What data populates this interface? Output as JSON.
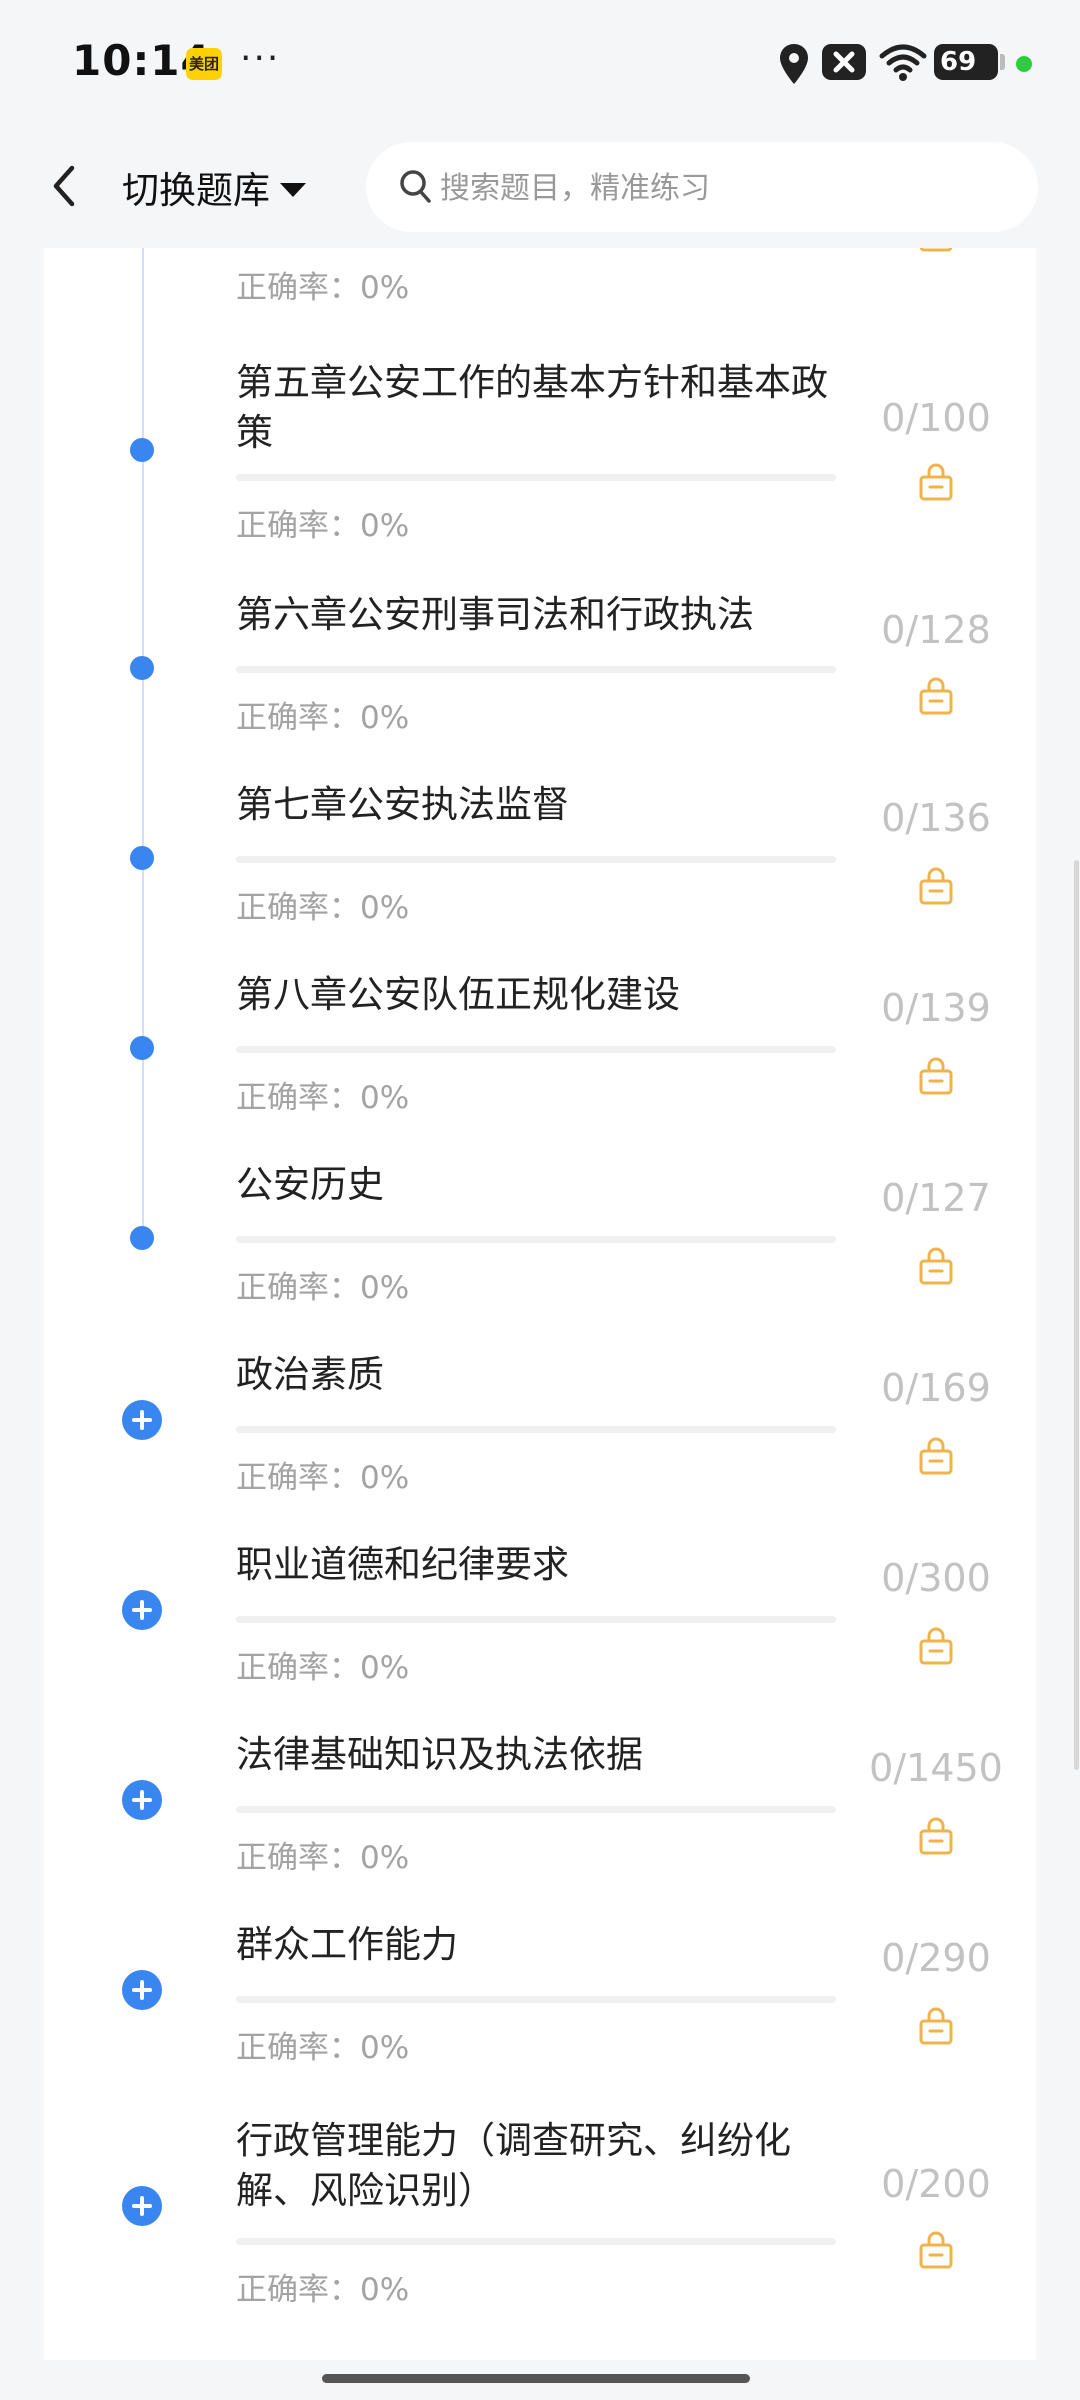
{
  "status_bar": {
    "time": "10:14",
    "app_badge": "美团",
    "more": "···",
    "battery": "69"
  },
  "header": {
    "switch_label": "切换题库",
    "search_placeholder": "搜索题目，精准练习"
  },
  "top_partial": {
    "accuracy": "正确率：0%"
  },
  "chapters": [
    {
      "title": "第五章公安工作的基本方针和基本政策",
      "count": "0/100",
      "accuracy": "正确率：0%",
      "marker": "dot",
      "progress": 0
    },
    {
      "title": "第六章公安刑事司法和行政执法",
      "count": "0/128",
      "accuracy": "正确率：0%",
      "marker": "dot",
      "progress": 0
    },
    {
      "title": "第七章公安执法监督",
      "count": "0/136",
      "accuracy": "正确率：0%",
      "marker": "dot",
      "progress": 0
    },
    {
      "title": "第八章公安队伍正规化建设",
      "count": "0/139",
      "accuracy": "正确率：0%",
      "marker": "dot",
      "progress": 0
    },
    {
      "title": "公安历史",
      "count": "0/127",
      "accuracy": "正确率：0%",
      "marker": "dot",
      "progress": 0
    },
    {
      "title": "政治素质",
      "count": "0/169",
      "accuracy": "正确率：0%",
      "marker": "plus",
      "progress": 0
    },
    {
      "title": "职业道德和纪律要求",
      "count": "0/300",
      "accuracy": "正确率：0%",
      "marker": "plus",
      "progress": 0
    },
    {
      "title": "法律基础知识及执法依据",
      "count": "0/1450",
      "accuracy": "正确率：0%",
      "marker": "plus",
      "progress": 0
    },
    {
      "title": "群众工作能力",
      "count": "0/290",
      "accuracy": "正确率：0%",
      "marker": "plus",
      "progress": 0
    },
    {
      "title": "行政管理能力（调查研究、纠纷化解、风险识别）",
      "count": "0/200",
      "accuracy": "正确率：0%",
      "marker": "plus",
      "progress": 0
    }
  ],
  "colors": {
    "accent": "#3a86f0",
    "lock": "#f0b34a",
    "count": "#c2c2c2"
  }
}
